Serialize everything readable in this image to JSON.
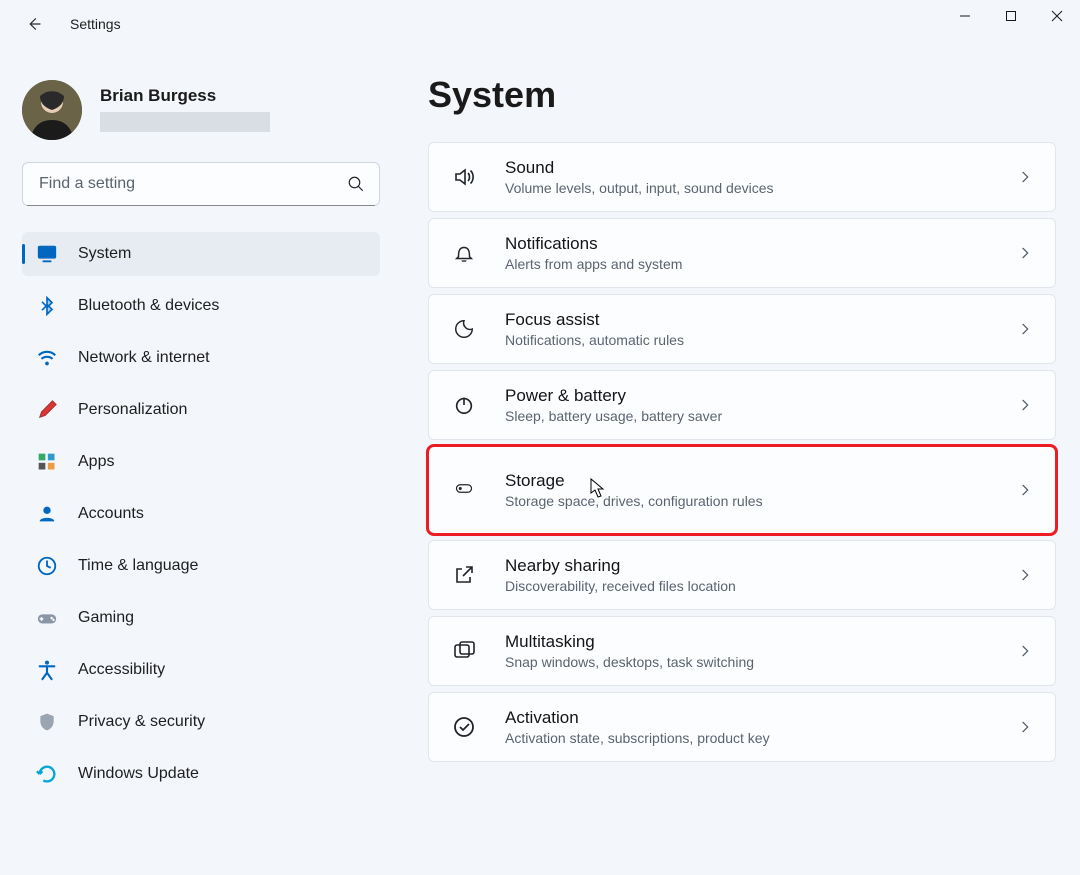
{
  "window": {
    "back_aria": "Back",
    "title": "Settings",
    "minimize_aria": "Minimize",
    "maximize_aria": "Maximize",
    "close_aria": "Close"
  },
  "profile": {
    "name": "Brian Burgess"
  },
  "search": {
    "placeholder": "Find a setting"
  },
  "nav": [
    {
      "name": "system",
      "label": "System",
      "active": true
    },
    {
      "name": "bluetooth-devices",
      "label": "Bluetooth & devices",
      "active": false
    },
    {
      "name": "network-internet",
      "label": "Network & internet",
      "active": false
    },
    {
      "name": "personalization",
      "label": "Personalization",
      "active": false
    },
    {
      "name": "apps",
      "label": "Apps",
      "active": false
    },
    {
      "name": "accounts",
      "label": "Accounts",
      "active": false
    },
    {
      "name": "time-language",
      "label": "Time & language",
      "active": false
    },
    {
      "name": "gaming",
      "label": "Gaming",
      "active": false
    },
    {
      "name": "accessibility",
      "label": "Accessibility",
      "active": false
    },
    {
      "name": "privacy-security",
      "label": "Privacy & security",
      "active": false
    },
    {
      "name": "windows-update",
      "label": "Windows Update",
      "active": false
    }
  ],
  "page": {
    "title": "System"
  },
  "cards": [
    {
      "name": "sound",
      "title": "Sound",
      "sub": "Volume levels, output, input, sound devices"
    },
    {
      "name": "notifications",
      "title": "Notifications",
      "sub": "Alerts from apps and system"
    },
    {
      "name": "focus-assist",
      "title": "Focus assist",
      "sub": "Notifications, automatic rules"
    },
    {
      "name": "power-battery",
      "title": "Power & battery",
      "sub": "Sleep, battery usage, battery saver"
    },
    {
      "name": "storage",
      "title": "Storage",
      "sub": "Storage space, drives, configuration rules",
      "highlighted": true,
      "cursor": true
    },
    {
      "name": "nearby-sharing",
      "title": "Nearby sharing",
      "sub": "Discoverability, received files location"
    },
    {
      "name": "multitasking",
      "title": "Multitasking",
      "sub": "Snap windows, desktops, task switching"
    },
    {
      "name": "activation",
      "title": "Activation",
      "sub": "Activation state, subscriptions, product key"
    }
  ],
  "icon_map": {
    "system": "<svg viewBox='0 0 24 24' width='22' height='22'><rect x='2' y='3' width='20' height='14' rx='2' fill='#0067c0'/><rect x='7' y='19' width='10' height='2' rx='1' fill='#0067c0'/></svg>",
    "bluetooth-devices": "<svg viewBox='0 0 24 24' width='20' height='20'><path d='M12 2 L18 8 L12 14 L12 2 Z M12 22 L18 16 L12 10 L12 22 Z M6 7 L12 13 M6 17 L12 11' stroke='#0067c0' stroke-width='2' fill='#0067c0' fill-opacity='.3'/></svg>",
    "network-internet": "<svg viewBox='0 0 24 24' width='22' height='22'><path d='M3 9 C8 4 16 4 21 9' stroke='#0067c0' stroke-width='2.3' fill='none'/><path d='M6 13 C9 10 15 10 18 13' stroke='#0067c0' stroke-width='2.3' fill='none'/><circle cx='12' cy='18' r='2' fill='#0067c0'/></svg>",
    "personalization": "<svg viewBox='0 0 24 24' width='22' height='22'><path d='M4 20 L6 14 L18 2 L22 6 L10 18 Z' fill='#d33' stroke='#933' stroke-width='1'/></svg>",
    "apps": "<svg viewBox='0 0 24 24' width='20' height='20'><rect x='2' y='2' width='8' height='8' fill='#3a6'/><rect x='13' y='2' width='8' height='8' fill='#39c'/><rect x='2' y='13' width='8' height='8' fill='#555'/><rect x='13' y='13' width='8' height='8' fill='#e94'/></svg>",
    "accounts": "<svg viewBox='0 0 24 24' width='22' height='22'><circle cx='12' cy='8' r='4' fill='#0067c0'/><path d='M4 20 C4 15 20 15 20 20 Z' fill='#0067c0'/></svg>",
    "time-language": "<svg viewBox='0 0 24 24' width='22' height='22'><circle cx='12' cy='12' r='9' fill='none' stroke='#0067c0' stroke-width='2'/><path d='M12 6 L12 12 L16 14' stroke='#0067c0' stroke-width='2' fill='none'/></svg>",
    "gaming": "<svg viewBox='0 0 24 24' width='24' height='22'><rect x='2' y='8' width='20' height='10' rx='5' fill='#8a96a6'/><circle cx='17' cy='12' r='1.3' fill='#fff'/><circle cx='19' cy='14' r='1.3' fill='#fff'/><path d='M6 11 L6 15 M4 13 L8 13' stroke='#fff' stroke-width='1.6'/></svg>",
    "accessibility": "<svg viewBox='0 0 24 24' width='22' height='22'><circle cx='12' cy='4' r='2.2' fill='#0067c0'/><path d='M4 8 L20 8 M12 8 L12 15 M12 15 L7 22 M12 15 L17 22' stroke='#0067c0' stroke-width='2.3' stroke-linecap='round'/></svg>",
    "privacy-security": "<svg viewBox='0 0 24 24' width='20' height='22'><path d='M12 2 L20 5 L20 11 C20 17 16 21 12 22 C8 21 4 17 4 11 L4 5 Z' fill='#9aa5b1'/></svg>",
    "windows-update": "<svg viewBox='0 0 24 24' width='22' height='22'><path d='M4 12 A8 8 0 1 1 8 19' stroke='#0aa5d9' stroke-width='2.6' fill='none'/><path d='M4 12 L1 9 M4 12 L7 9' stroke='#0aa5d9' stroke-width='2.6'/></svg>",
    "sound": "<svg viewBox='0 0 24 24' width='24' height='24' stroke='#20242a' stroke-width='1.6' fill='none'><path d='M4 9 L8 9 L13 5 L13 19 L8 15 L4 15 Z' fill='#20242a' fill-opacity='0'/><path d='M16 8 C18 10 18 14 16 16'/><path d='M18.5 5.5 C22 9 22 15 18.5 18.5'/></svg>",
    "notifications": "<svg viewBox='0 0 24 24' width='22' height='22' stroke='#20242a' stroke-width='1.6' fill='none'><path d='M6 16 C6 10 7 6 12 6 C17 6 18 10 18 16 L20 18 L4 18 Z'/><path d='M10 20 C10 21 14 21 14 20'/></svg>",
    "focus-assist": "<svg viewBox='0 0 24 24' width='22' height='22' stroke='#20242a' stroke-width='1.6' fill='none'><path d='M12 3 A9 9 0 1 0 21 12 A7 7 0 0 1 12 3 Z'/></svg>",
    "power-battery": "<svg viewBox='0 0 24 24' width='22' height='22' stroke='#20242a' stroke-width='1.8' fill='none'><circle cx='12' cy='13' r='8'/><path d='M12 4 L12 12'/></svg>",
    "storage": "<svg viewBox='0 0 24 24' width='26' height='18' stroke='#20242a' stroke-width='1.6' fill='none'><rect x='2' y='5' width='20' height='10' rx='5'/><circle cx='7' cy='10' r='1.2' fill='#20242a'/></svg>",
    "nearby-sharing": "<svg viewBox='0 0 24 24' width='24' height='24' stroke='#20242a' stroke-width='1.6' fill='none'><path d='M14 4 L20 4 L20 10'/><path d='M20 4 L11 13'/><path d='M18 14 L18 19 L5 19 L5 6 L10 6'/></svg>",
    "multitasking": "<svg viewBox='0 0 24 24' width='24' height='24' stroke='#20242a' stroke-width='1.6' fill='none'><rect x='3' y='6' width='14' height='12' rx='2'/><rect x='8' y='3' width='14' height='12' rx='2'/></svg>",
    "activation": "<svg viewBox='0 0 24 24' width='24' height='24' stroke='#20242a' stroke-width='1.8' fill='none'><circle cx='12' cy='12' r='9'/><path d='M8 12 L11 15 L17 9'/></svg>"
  }
}
